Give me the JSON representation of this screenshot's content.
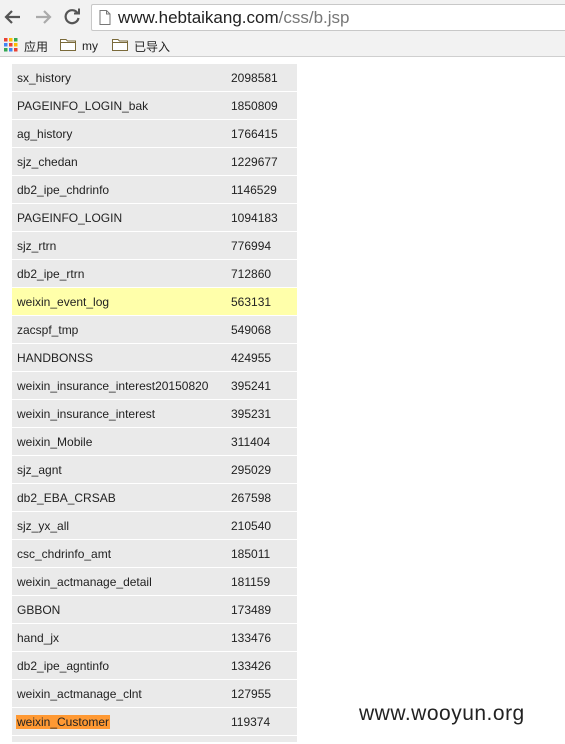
{
  "browser": {
    "url_main": "www.hebtaikang.com",
    "url_path": "/css/b.jsp",
    "bookmarks": [
      {
        "label": "应用",
        "icon": "apps-grid-icon"
      },
      {
        "label": "my",
        "icon": "folder-icon"
      },
      {
        "label": "已导入",
        "icon": "folder-icon"
      }
    ]
  },
  "table": {
    "rows": [
      {
        "name": "sx_history",
        "count": "2098581"
      },
      {
        "name": "PAGEINFO_LOGIN_bak",
        "count": "1850809"
      },
      {
        "name": "ag_history",
        "count": "1766415"
      },
      {
        "name": "sjz_chedan",
        "count": "1229677"
      },
      {
        "name": "db2_ipe_chdrinfo",
        "count": "1146529"
      },
      {
        "name": "PAGEINFO_LOGIN",
        "count": "1094183"
      },
      {
        "name": "sjz_rtrn",
        "count": "776994"
      },
      {
        "name": "db2_ipe_rtrn",
        "count": "712860"
      },
      {
        "name": "weixin_event_log",
        "count": "563131"
      },
      {
        "name": "zacspf_tmp",
        "count": "549068"
      },
      {
        "name": "HANDBONSS",
        "count": "424955"
      },
      {
        "name": "weixin_insurance_interest20150820",
        "count": "395241"
      },
      {
        "name": "weixin_insurance_interest",
        "count": "395231"
      },
      {
        "name": "weixin_Mobile",
        "count": "311404"
      },
      {
        "name": "sjz_agnt",
        "count": "295029"
      },
      {
        "name": "db2_EBA_CRSAB",
        "count": "267598"
      },
      {
        "name": "sjz_yx_all",
        "count": "210540"
      },
      {
        "name": "csc_chdrinfo_amt",
        "count": "185011"
      },
      {
        "name": "weixin_actmanage_detail",
        "count": "181159"
      },
      {
        "name": "GBBON",
        "count": "173489"
      },
      {
        "name": "hand_jx",
        "count": "133476"
      },
      {
        "name": "db2_ipe_agntinfo",
        "count": "133426"
      },
      {
        "name": "weixin_actmanage_clnt",
        "count": "127955"
      },
      {
        "name": "weixin_Customer",
        "count": "119374"
      }
    ],
    "highlight_color": "#ffffaa",
    "mark_color": "#ff9933"
  },
  "watermark": "www.wooyun.org"
}
